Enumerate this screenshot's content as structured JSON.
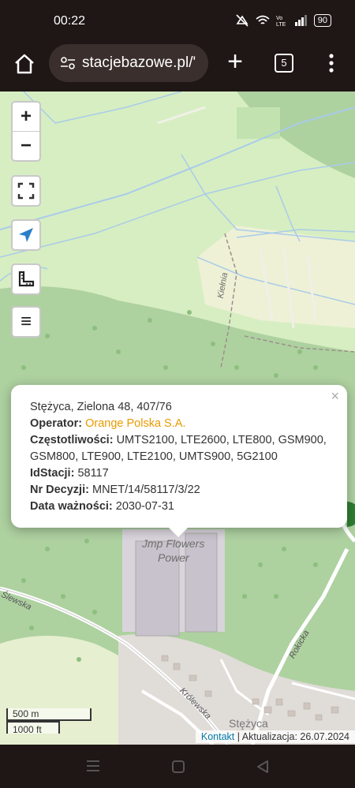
{
  "status_bar": {
    "time": "00:22",
    "battery": "90"
  },
  "browser": {
    "url": "stacjebazowe.pl/'",
    "tab_count": "5"
  },
  "map_labels": {
    "road1": "Kiełnia",
    "factory": "Jmp Flowers",
    "factory2": "Power",
    "road2": "Rokicka",
    "road3": "Królewska",
    "road4": "Ślewska",
    "town": "Stężyca"
  },
  "controls": {
    "zoom_in": "+",
    "zoom_out": "−",
    "layers": "≡"
  },
  "popup": {
    "address": "Stężyca, Zielona 48, 407/76",
    "operator_label": "Operator:",
    "operator_value": "Orange Polska S.A.",
    "freq_label": "Częstotliwości:",
    "freq_value": "UMTS2100, LTE2600, LTE800, GSM900, GSM800, LTE900, LTE2100, UMTS900, 5G2100",
    "id_label": "IdStacji:",
    "id_value": "58117",
    "decision_label": "Nr Decyzji:",
    "decision_value": "MNET/14/58117/3/22",
    "validity_label": "Data ważności:",
    "validity_value": "2030-07-31",
    "close": "×"
  },
  "scale": {
    "metric": "500 m",
    "imperial": "1000 ft"
  },
  "attribution": {
    "contact": "Kontakt",
    "update": " | Aktualizacja: 26.07.2024"
  },
  "colors": {
    "operator": "#e89a00",
    "link": "#0078a8",
    "forest": "#aed1a0",
    "meadow": "#d7eec2"
  }
}
